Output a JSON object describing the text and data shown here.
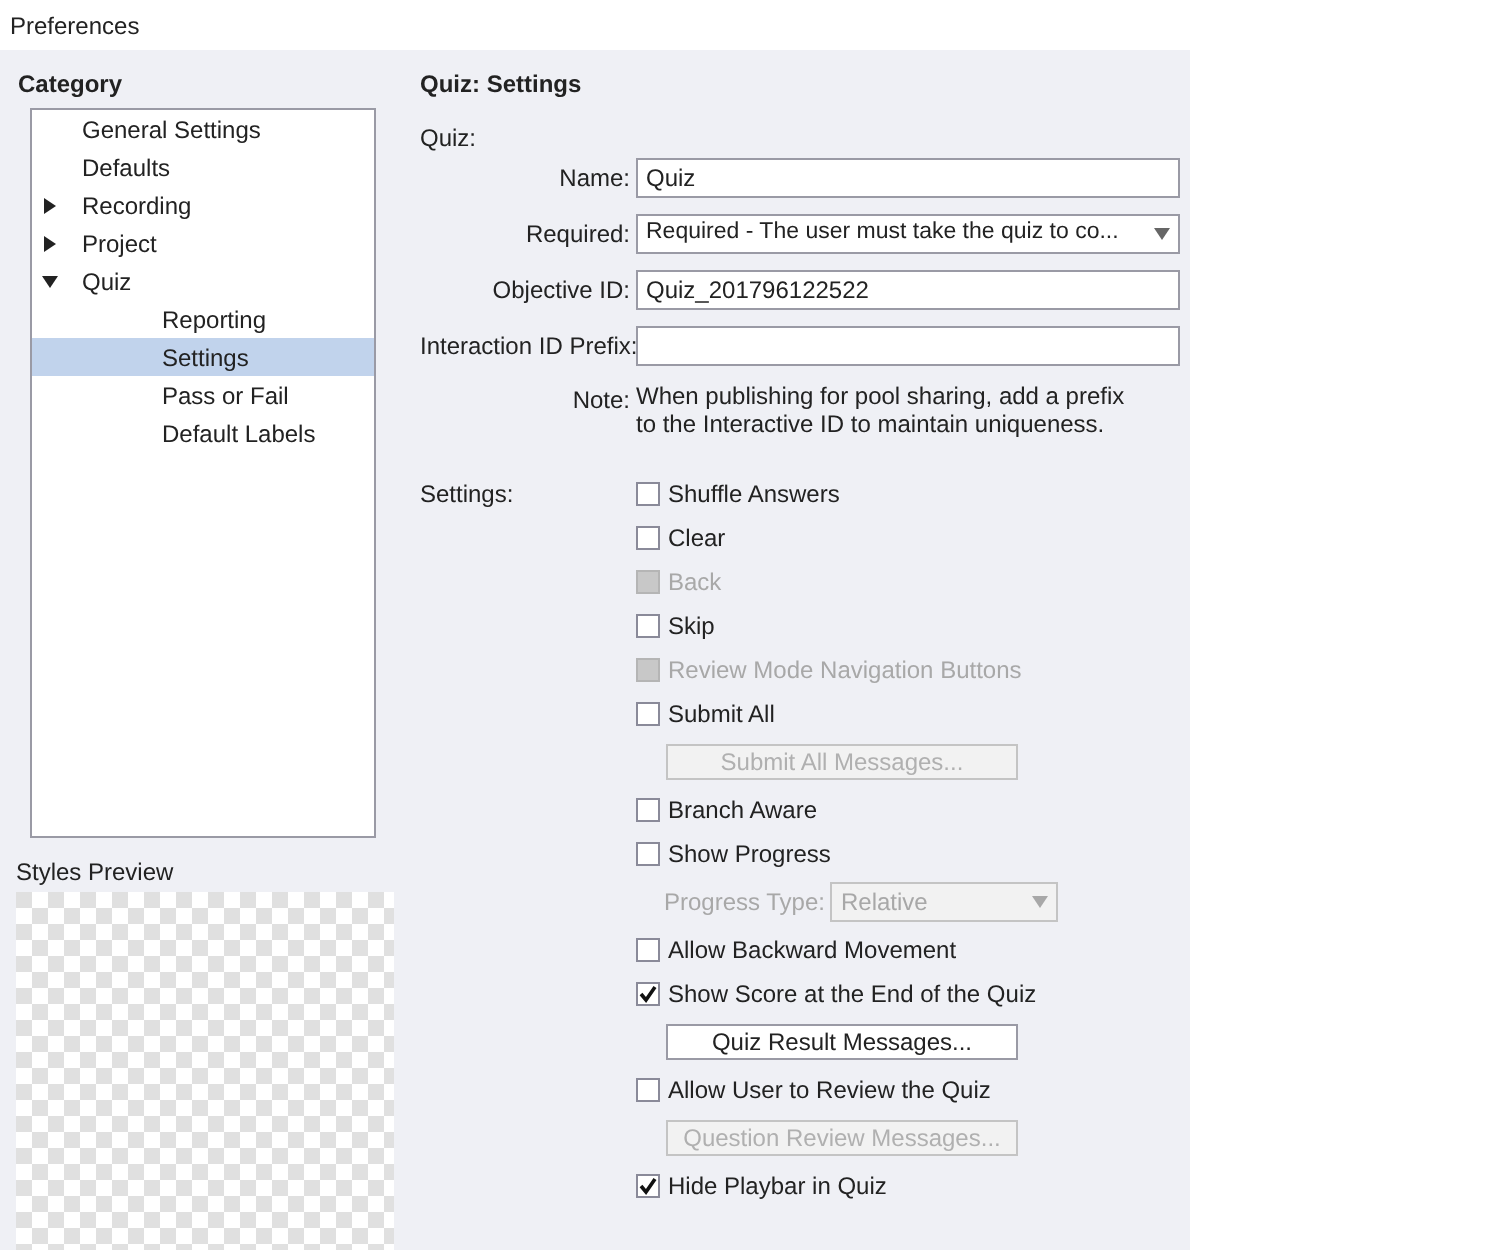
{
  "window": {
    "title": "Preferences"
  },
  "category": {
    "heading": "Category",
    "items": [
      {
        "label": "General Settings",
        "selected": false
      },
      {
        "label": "Defaults",
        "selected": false
      },
      {
        "label": "Recording",
        "selected": false,
        "expanded": false
      },
      {
        "label": "Project",
        "selected": false,
        "expanded": false
      },
      {
        "label": "Quiz",
        "selected": false,
        "expanded": true,
        "children": [
          {
            "label": "Reporting",
            "selected": false
          },
          {
            "label": "Settings",
            "selected": true
          },
          {
            "label": "Pass or Fail",
            "selected": false
          },
          {
            "label": "Default Labels",
            "selected": false
          }
        ]
      }
    ]
  },
  "styles_preview": {
    "label": "Styles Preview"
  },
  "panel": {
    "title": "Quiz: Settings",
    "section": "Quiz:",
    "fields": [
      {
        "kind": "text",
        "label": "Name:",
        "value": "Quiz"
      },
      {
        "kind": "select",
        "label": "Required:",
        "value": "Required - The user must take the quiz to co..."
      },
      {
        "kind": "text",
        "label": "Objective ID:",
        "value": "Quiz_201796122522"
      },
      {
        "kind": "text",
        "label": "Interaction ID Prefix:"
      }
    ],
    "note": {
      "label": "Note:",
      "text": "When publishing for pool sharing, add a prefix to the Interactive ID to maintain uniqueness."
    },
    "settings_label": "Settings:",
    "settings": [
      {
        "kind": "checkbox",
        "label": "Shuffle Answers",
        "checked": false,
        "disabled": false
      },
      {
        "kind": "checkbox",
        "label": "Clear",
        "checked": false,
        "disabled": false
      },
      {
        "kind": "checkbox",
        "label": "Back",
        "checked": false,
        "disabled": true
      },
      {
        "kind": "checkbox",
        "label": "Skip",
        "checked": false,
        "disabled": false
      },
      {
        "kind": "checkbox",
        "label": "Review Mode Navigation Buttons",
        "checked": false,
        "disabled": true
      },
      {
        "kind": "checkbox",
        "label": "Submit All",
        "checked": false,
        "disabled": false
      },
      {
        "kind": "button",
        "label": "Submit All Messages...",
        "disabled": true
      },
      {
        "kind": "checkbox",
        "label": "Branch Aware",
        "checked": false,
        "disabled": false
      },
      {
        "kind": "checkbox",
        "label": "Show Progress",
        "checked": false,
        "disabled": false
      },
      {
        "kind": "select",
        "label": "Progress Type:",
        "value": "Relative",
        "disabled": true
      },
      {
        "kind": "checkbox",
        "label": "Allow Backward Movement",
        "checked": false,
        "disabled": false
      },
      {
        "kind": "checkbox",
        "label": "Show Score at the End of the Quiz",
        "checked": true,
        "disabled": false
      },
      {
        "kind": "button",
        "label": "Quiz Result Messages...",
        "disabled": false
      },
      {
        "kind": "checkbox",
        "label": "Allow User to Review the Quiz",
        "checked": false,
        "disabled": false
      },
      {
        "kind": "button",
        "label": "Question Review Messages...",
        "disabled": true
      },
      {
        "kind": "checkbox",
        "label": "Hide Playbar in Quiz",
        "checked": true,
        "disabled": false
      }
    ]
  }
}
